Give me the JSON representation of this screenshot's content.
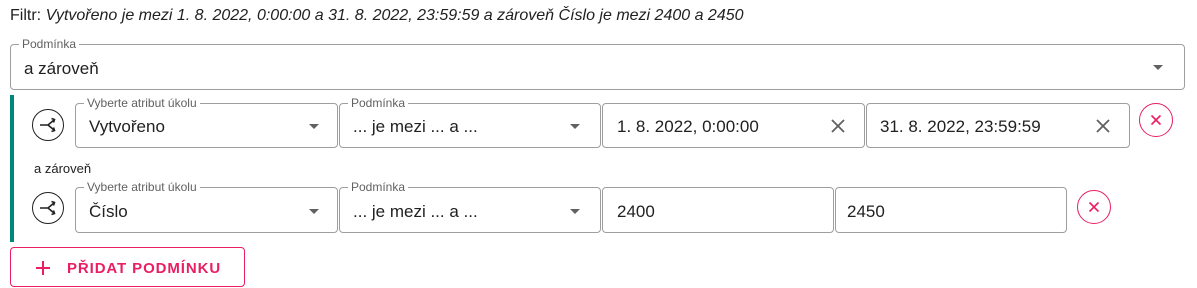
{
  "filter_summary": {
    "label": "Filtr:",
    "text": "Vytvořeno je mezi 1. 8. 2022, 0:00:00 a 31. 8. 2022, 23:59:59 a zároveň Číslo je mezi 2400 a 2450"
  },
  "group_operator": {
    "legend": "Podmínka",
    "value": "a zároveň"
  },
  "conditions": [
    {
      "attribute_legend": "Vyberte atribut úkolu",
      "attribute_value": "Vytvořeno",
      "operator_legend": "Podmínka",
      "operator_value": "... je mezi ... a ...",
      "value_from": "1. 8. 2022, 0:00:00",
      "value_to": "31. 8. 2022, 23:59:59"
    },
    {
      "attribute_legend": "Vyberte atribut úkolu",
      "attribute_value": "Číslo",
      "operator_legend": "Podmínka",
      "operator_value": "... je mezi ... a ...",
      "value_from": "2400",
      "value_to": "2450"
    }
  ],
  "join_label": "a zároveň",
  "add_condition_label": "PŘIDAT PODMÍNKU",
  "icons": {
    "branch": "branch-split-icon",
    "remove": "close-circle-icon",
    "clear": "close-icon",
    "dropdown": "triangle-down-icon",
    "add": "plus-icon"
  },
  "colors": {
    "accent": "#e91e63",
    "group_bar": "#00897b",
    "border": "#9e9e9e"
  }
}
